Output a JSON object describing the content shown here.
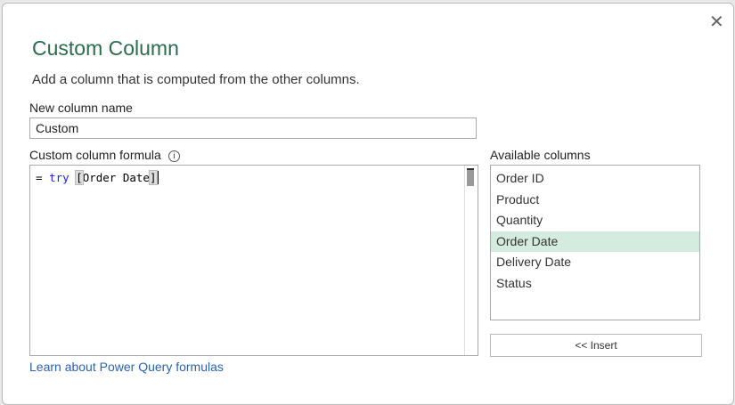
{
  "dialog": {
    "title": "Custom Column",
    "subtitle": "Add a column that is computed from the other columns.",
    "close_icon": "close-icon"
  },
  "name_label": "New column name",
  "name_value": "Custom",
  "formula_label": "Custom column formula",
  "info_icon": "i",
  "formula": {
    "eq": "=",
    "keyword": "try",
    "open": "[",
    "field": "Order Date",
    "close": "]"
  },
  "available_label": "Available columns",
  "columns": [
    "Order ID",
    "Product",
    "Quantity",
    "Order Date",
    "Delivery Date",
    "Status"
  ],
  "selected_column": "Order Date",
  "insert_label": "<< Insert",
  "learn_link": "Learn about Power Query formulas"
}
